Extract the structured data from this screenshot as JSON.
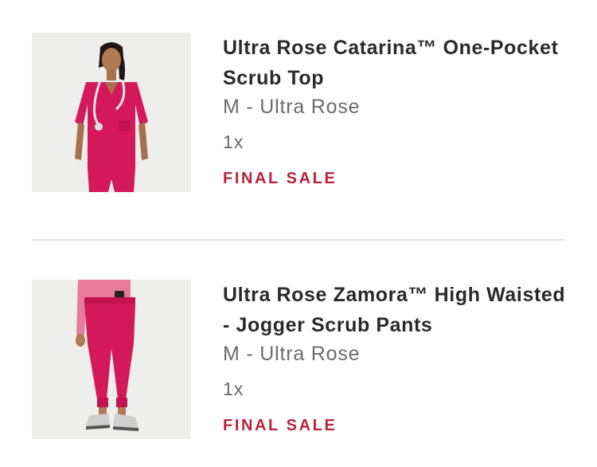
{
  "cart": {
    "items": [
      {
        "title": "Ultra Rose Catarina™ One-Pocket Scrub Top",
        "variant": "M - Ultra Rose",
        "quantity": "1x",
        "badge": "FINAL SALE",
        "image_icon": "scrub-top-product-image"
      },
      {
        "title": "Ultra Rose Zamora™ High Waisted - Jogger Scrub Pants",
        "variant": "M - Ultra Rose",
        "quantity": "1x",
        "badge": "FINAL SALE",
        "image_icon": "scrub-pants-product-image"
      }
    ],
    "colors": {
      "badge": "#b8243b",
      "product": "#d4195a"
    }
  }
}
